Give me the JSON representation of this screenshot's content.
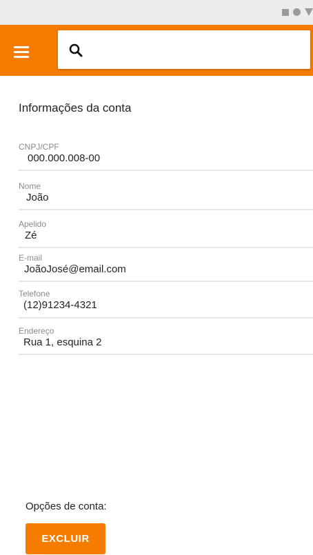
{
  "status_bar": {
    "icons": [
      "square-icon",
      "circle-icon",
      "triangle-icon"
    ]
  },
  "app_bar": {
    "menu_icon": "hamburger-menu-icon",
    "search_icon": "search-icon",
    "search_value": "",
    "color": "#f57c00"
  },
  "account": {
    "title": "Informações da conta",
    "fields": [
      {
        "label": "CNPJ/CPF",
        "value": "000.000.008-00"
      },
      {
        "label": "Nome",
        "value": "João"
      },
      {
        "label": "Apelido",
        "value": "Zé"
      },
      {
        "label": "E-mail",
        "value": "JoãoJosé@email.com"
      },
      {
        "label": "Telefone",
        "value": "(12)91234-4321"
      },
      {
        "label": "Endereço",
        "value": "Rua 1, esquina 2"
      }
    ]
  },
  "options": {
    "label": "Opções de conta:",
    "delete_button": "EXCLUIR"
  }
}
